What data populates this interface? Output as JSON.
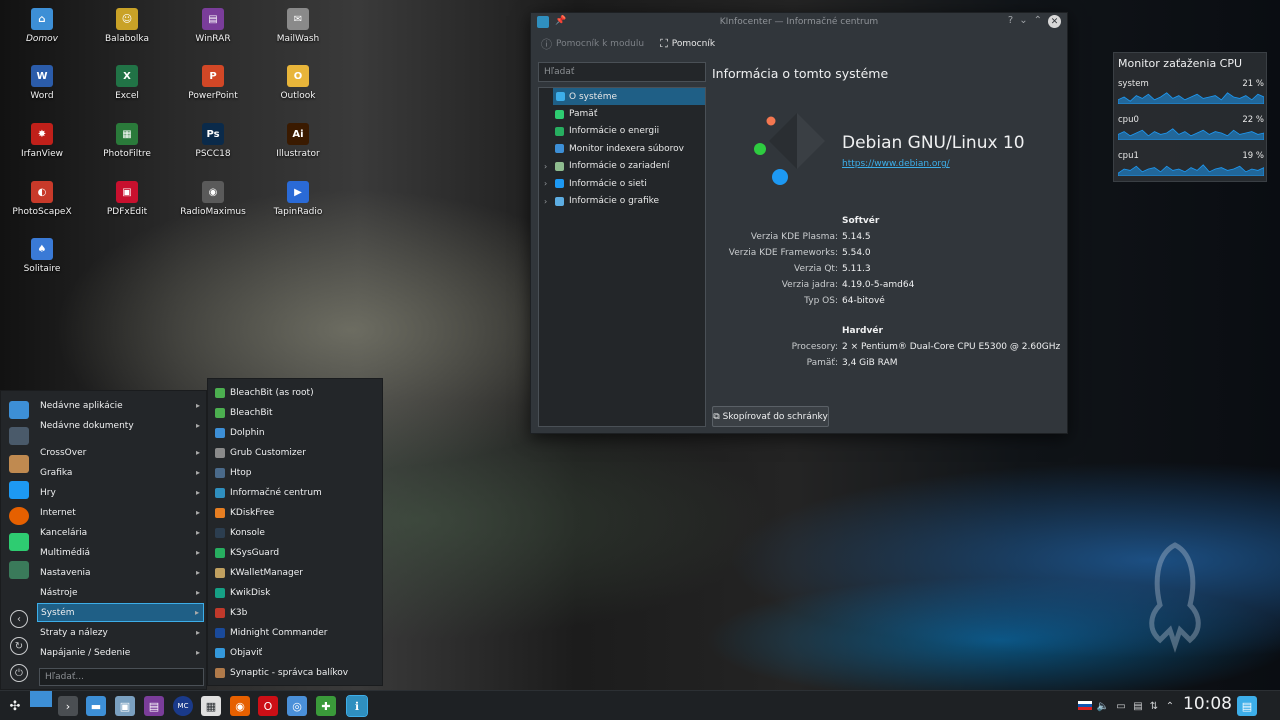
{
  "desktop": {
    "icons": [
      {
        "label": "Domov",
        "icon": "folder-home-icon",
        "color": "#3d8fd6",
        "glyph": "⌂"
      },
      {
        "label": "Balabolka",
        "icon": "balabolka-icon",
        "color": "#c9a227",
        "glyph": "☺"
      },
      {
        "label": "WinRAR",
        "icon": "winrar-icon",
        "color": "#7a3d9a",
        "glyph": "▤"
      },
      {
        "label": "MailWash",
        "icon": "mailwash-icon",
        "color": "#8a8a8a",
        "glyph": "✉"
      },
      {
        "label": "Word",
        "icon": "word-icon",
        "color": "#2b5caa",
        "glyph": "W"
      },
      {
        "label": "Excel",
        "icon": "excel-icon",
        "color": "#217346",
        "glyph": "X"
      },
      {
        "label": "PowerPoint",
        "icon": "powerpoint-icon",
        "color": "#d24726",
        "glyph": "P"
      },
      {
        "label": "Outlook",
        "icon": "outlook-icon",
        "color": "#e8b53a",
        "glyph": "O"
      },
      {
        "label": "IrfanView",
        "icon": "irfanview-icon",
        "color": "#c0201a",
        "glyph": "✸"
      },
      {
        "label": "PhotoFiltre",
        "icon": "photofiltre-icon",
        "color": "#2a7a3a",
        "glyph": "▦"
      },
      {
        "label": "PSCC18",
        "icon": "photoshop-icon",
        "color": "#0a2a4a",
        "glyph": "Ps"
      },
      {
        "label": "Illustrator",
        "icon": "illustrator-icon",
        "color": "#3a1a00",
        "glyph": "Ai"
      },
      {
        "label": "PhotoScapeX",
        "icon": "photoscape-icon",
        "color": "#c83a2a",
        "glyph": "◐"
      },
      {
        "label": "PDFxEdit",
        "icon": "pdfxedit-icon",
        "color": "#c8102e",
        "glyph": "▣"
      },
      {
        "label": "RadioMaximus",
        "icon": "radiomaximus-icon",
        "color": "#5a5a5a",
        "glyph": "◉"
      },
      {
        "label": "TapinRadio",
        "icon": "tapinradio-icon",
        "color": "#2a6ad6",
        "glyph": "▶"
      },
      {
        "label": "Solitaire",
        "icon": "solitaire-icon",
        "color": "#3a7ad6",
        "glyph": "♠"
      }
    ]
  },
  "window": {
    "title": "KInfocenter — Informačné centrum",
    "help_module": "Pomocník k modulu",
    "help": "Pomocník",
    "search_placeholder": "Hľadať",
    "tree": [
      {
        "label": "O systéme",
        "color": "#3daee9",
        "expander": "",
        "selected": true
      },
      {
        "label": "Pamäť",
        "color": "#2ecc71",
        "expander": ""
      },
      {
        "label": "Informácie o energii",
        "color": "#27ae60",
        "expander": ""
      },
      {
        "label": "Monitor indexera súborov",
        "color": "#3d8fd6",
        "expander": ""
      },
      {
        "label": "Informácie o zariadení",
        "color": "#8fbc8f",
        "expander": "›"
      },
      {
        "label": "Informácie o sieti",
        "color": "#1d99f3",
        "expander": "›"
      },
      {
        "label": "Informácie o grafike",
        "color": "#5dade2",
        "expander": "›"
      }
    ],
    "content_title": "Informácia o tomto systéme",
    "os_name": "Debian GNU/Linux 10",
    "os_url": "https://www.debian.org/",
    "software_heading": "Softvér",
    "software": [
      {
        "key": "Verzia KDE Plasma:",
        "value": "5.14.5"
      },
      {
        "key": "Verzia KDE Frameworks:",
        "value": "5.54.0"
      },
      {
        "key": "Verzia Qt:",
        "value": "5.11.3"
      },
      {
        "key": "Verzia jadra:",
        "value": "4.19.0-5-amd64"
      },
      {
        "key": "Typ OS:",
        "value": "64-bitové"
      }
    ],
    "hardware_heading": "Hardvér",
    "hardware": [
      {
        "key": "Procesory:",
        "value": "2 × Pentium® Dual-Core CPU E5300 @ 2.60GHz"
      },
      {
        "key": "Pamäť:",
        "value": "3,4 GiB RAM"
      }
    ],
    "copy_button": "Skopírovať do schránky"
  },
  "cpu_widget": {
    "title": "Monitor zaťaženia CPU",
    "accent": "#1d99f3",
    "rows": [
      {
        "name": "system",
        "percent": "21 %",
        "samples": [
          0.3,
          0.5,
          0.2,
          0.6,
          0.4,
          0.7,
          0.3,
          0.5,
          0.8,
          0.4,
          0.6,
          0.3,
          0.5,
          0.7,
          0.4,
          0.5,
          0.6,
          0.3,
          0.8,
          0.5,
          0.4,
          0.6,
          0.3,
          0.7,
          0.5
        ]
      },
      {
        "name": "cpu0",
        "percent": "22 %",
        "samples": [
          0.4,
          0.6,
          0.3,
          0.5,
          0.7,
          0.3,
          0.6,
          0.4,
          0.5,
          0.8,
          0.4,
          0.6,
          0.3,
          0.5,
          0.7,
          0.4,
          0.6,
          0.5,
          0.3,
          0.7,
          0.4,
          0.5,
          0.6,
          0.4,
          0.5
        ]
      },
      {
        "name": "cpu1",
        "percent": "19 %",
        "samples": [
          0.2,
          0.5,
          0.4,
          0.7,
          0.3,
          0.5,
          0.6,
          0.3,
          0.7,
          0.4,
          0.5,
          0.3,
          0.6,
          0.4,
          0.8,
          0.3,
          0.5,
          0.6,
          0.4,
          0.5,
          0.7,
          0.3,
          0.5,
          0.4,
          0.6
        ]
      }
    ]
  },
  "start_menu": {
    "items": [
      {
        "label": "Nedávne aplikácie",
        "arrow": "▸"
      },
      {
        "label": "Nedávne dokumenty",
        "arrow": "▸"
      },
      {
        "label": "CrossOver",
        "arrow": "▸"
      },
      {
        "label": "Grafika",
        "arrow": "▸"
      },
      {
        "label": "Hry",
        "arrow": "▸"
      },
      {
        "label": "Internet",
        "arrow": "▸"
      },
      {
        "label": "Kancelária",
        "arrow": "▸"
      },
      {
        "label": "Multimédiá",
        "arrow": "▸"
      },
      {
        "label": "Nastavenia",
        "arrow": "▸"
      },
      {
        "label": "Nástroje",
        "arrow": "▸"
      },
      {
        "label": "Systém",
        "arrow": "▸",
        "selected": true
      },
      {
        "label": "Straty a nálezy",
        "arrow": "▸"
      },
      {
        "label": "Napájanie / Sedenie",
        "arrow": "▸"
      }
    ],
    "search_placeholder": "Hľadať...",
    "submenu": [
      {
        "label": "BleachBit (as root)",
        "color": "#4caf50"
      },
      {
        "label": "BleachBit",
        "color": "#4caf50"
      },
      {
        "label": "Dolphin",
        "color": "#3d8fd6"
      },
      {
        "label": "Grub Customizer",
        "color": "#8a8a8a"
      },
      {
        "label": "Htop",
        "color": "#4a6a8a"
      },
      {
        "label": "Informačné centrum",
        "color": "#2f8fbf"
      },
      {
        "label": "KDiskFree",
        "color": "#e67e22"
      },
      {
        "label": "Konsole",
        "color": "#2c3e50"
      },
      {
        "label": "KSysGuard",
        "color": "#27ae60"
      },
      {
        "label": "KWalletManager",
        "color": "#c0a060"
      },
      {
        "label": "KwikDisk",
        "color": "#16a085"
      },
      {
        "label": "K3b",
        "color": "#c0392b"
      },
      {
        "label": "Midnight Commander",
        "color": "#1a4a9a"
      },
      {
        "label": "Objaviť",
        "color": "#3498db"
      },
      {
        "label": "Synaptic - správca balíkov",
        "color": "#b07a4a"
      }
    ]
  },
  "taskbar": {
    "clock": "10:08",
    "items": [
      {
        "icon": "pager-icon",
        "glyph": "",
        "color": "#3d8fd6"
      },
      {
        "icon": "terminal-icon",
        "glyph": "›",
        "color": "#4a4e52"
      },
      {
        "icon": "dolphin-icon",
        "glyph": "▬",
        "color": "#3d8fd6"
      },
      {
        "icon": "image-viewer-icon",
        "glyph": "▣",
        "color": "#7aa0c0"
      },
      {
        "icon": "winrar-icon",
        "glyph": "▤",
        "color": "#7a3d9a"
      },
      {
        "icon": "midnight-commander-icon",
        "glyph": "MC",
        "color": "#1a3a8a"
      },
      {
        "icon": "text-editor-icon",
        "glyph": "▦",
        "color": "#e0e0e0"
      },
      {
        "icon": "firefox-icon",
        "glyph": "◉",
        "color": "#e66000"
      },
      {
        "icon": "opera-icon",
        "glyph": "O",
        "color": "#cc0f16"
      },
      {
        "icon": "chromium-icon",
        "glyph": "◎",
        "color": "#4a90d9"
      },
      {
        "icon": "crossover-icon",
        "glyph": "✚",
        "color": "#3a9a3a"
      },
      {
        "icon": "kinfocenter-icon",
        "glyph": "ℹ",
        "color": "#2f8fbf"
      }
    ]
  }
}
